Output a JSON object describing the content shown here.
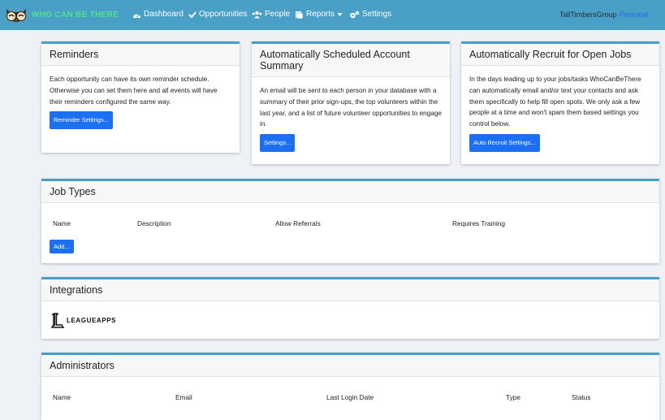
{
  "nav": {
    "brand": "WHO CAN BE THERE",
    "items": [
      {
        "label": "Dashboard",
        "icon": "dashboard-icon"
      },
      {
        "label": "Opportunities",
        "icon": "check-icon"
      },
      {
        "label": "People",
        "icon": "people-icon"
      },
      {
        "label": "Reports",
        "icon": "reports-icon"
      },
      {
        "label": "Settings",
        "icon": "gears-icon"
      }
    ],
    "account": "TallTimbersGroup",
    "account_type": "Personal"
  },
  "reminders": {
    "title": "Reminders",
    "body": "Each opportunity can have its own reminder schedule. Otherwise you can set them here and all events will have their reminders configured the same way.",
    "button": "Reminder Settings..."
  },
  "summary": {
    "title": "Automatically Scheduled Account Summary",
    "body": "An email will be sent to each person in your database with a summary of their prior sign-ups, the top volunteers within the last year, and a list of future volunteer opportunities to engage in.",
    "button": "Settings..."
  },
  "recruit": {
    "title": "Automatically Recruit for Open Jobs",
    "body": "In the days leading up to your jobs/tasks WhoCanBeThere can automatically email and/or text your contacts and ask them specifically to help fill open spots. We only ask a few people at a time and won't spam them based settings you control below.",
    "button": "Auto Recruit Settings..."
  },
  "job_types": {
    "title": "Job Types",
    "columns": [
      "Name",
      "Description",
      "Allow Referrals",
      "Requires Training"
    ],
    "button": "Add..."
  },
  "integrations": {
    "title": "Integrations",
    "leagueapps_text": "LEAGUEAPPS"
  },
  "administrators": {
    "title": "Administrators",
    "columns": [
      "Name",
      "Email",
      "Last Login Date",
      "Type",
      "Status"
    ]
  }
}
